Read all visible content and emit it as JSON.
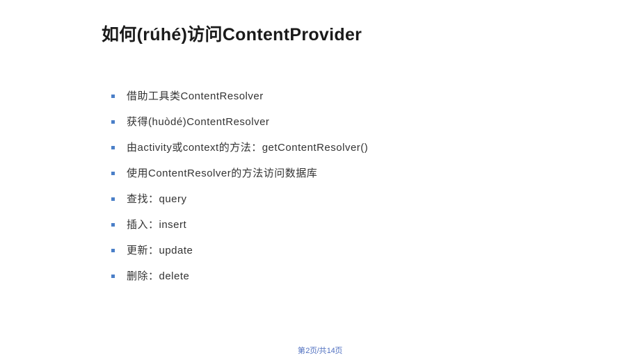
{
  "title": "如何(rúhé)访问ContentProvider",
  "bullets": [
    "借助工具类ContentResolver",
    "获得(huòdé)ContentResolver",
    "由activity或context的方法：getContentResolver()",
    "使用ContentResolver的方法访问数据库",
    "查找：query",
    "插入：insert",
    "更新：update",
    "删除：delete"
  ],
  "footer": "第 2页/共 14页"
}
